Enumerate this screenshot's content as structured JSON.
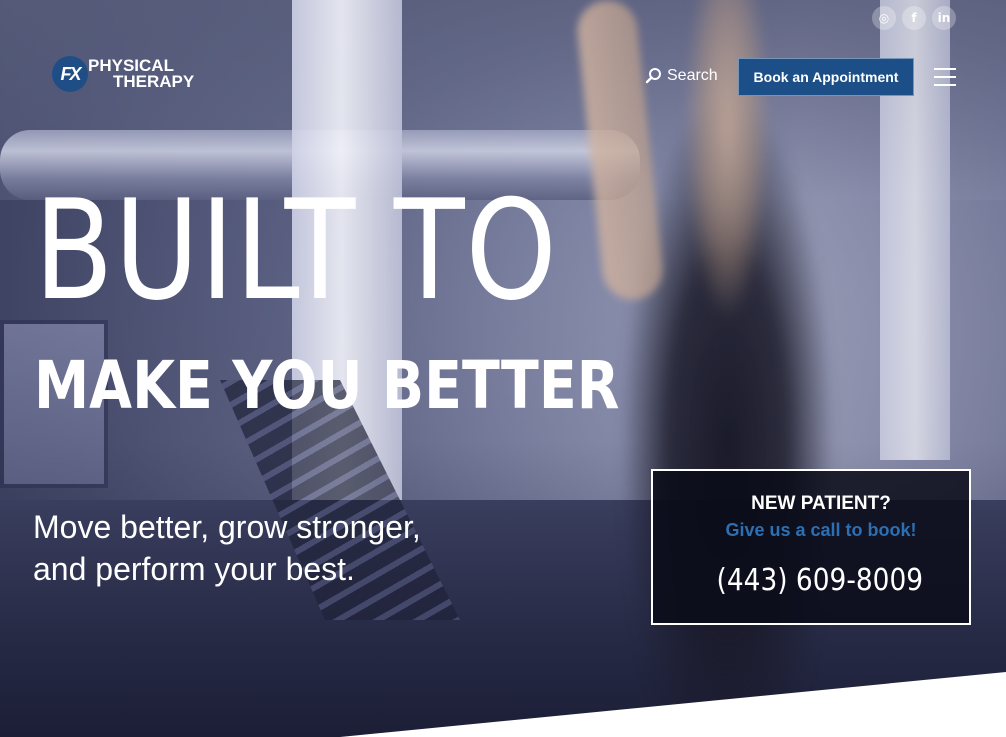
{
  "header": {
    "logo_mark": "FX",
    "logo_line1": "PHYSICAL",
    "logo_line2": "THERAPY",
    "search_label": "Search",
    "book_button": "Book an Appointment"
  },
  "social": [
    {
      "icon": "instagram-icon",
      "glyph": "◎"
    },
    {
      "icon": "facebook-icon",
      "glyph": "f"
    },
    {
      "icon": "linkedin-icon",
      "glyph": "in"
    }
  ],
  "hero": {
    "line1": "BUILT TO",
    "line2": "MAKE YOU BETTER",
    "tagline": "Move better, grow stronger, and perform your best."
  },
  "new_patient": {
    "title": "NEW PATIENT?",
    "subtitle": "Give us a call to book!",
    "phone": "(443) 609-8009"
  },
  "colors": {
    "brand_blue": "#1c4f88",
    "accent_blue": "#2c6fb3"
  }
}
